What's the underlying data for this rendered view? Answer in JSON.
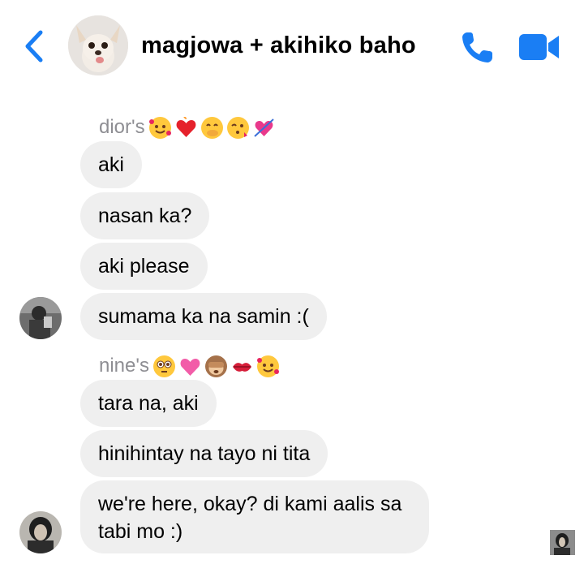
{
  "header": {
    "title": "magjowa + akihiko baho",
    "icons": {
      "back": "chevron-left-icon",
      "call": "phone-icon",
      "video": "video-camera-icon"
    },
    "accent_color": "#1a7ef4"
  },
  "groups": [
    {
      "sender_name": "dior's",
      "emojis": [
        "smiling-face-with-hearts",
        "heart-on-fire",
        "face-with-hand-over-mouth",
        "face-blowing-kiss",
        "heart-with-arrow"
      ],
      "messages": [
        "aki",
        "nasan ka?",
        "aki please",
        "sumama ka na samin :("
      ]
    },
    {
      "sender_name": "nine's",
      "emojis": [
        "flushed-face",
        "growing-heart",
        "see-no-evil-monkey",
        "kiss-mark",
        "smiling-face-with-hearts"
      ],
      "messages": [
        "tara na, aki",
        "hinihintay na tayo ni tita",
        "we're here, okay? di kami aalis sa tabi mo :)"
      ]
    }
  ],
  "bubble_color": "#efefef",
  "sender_label_color": "#8e8e93"
}
